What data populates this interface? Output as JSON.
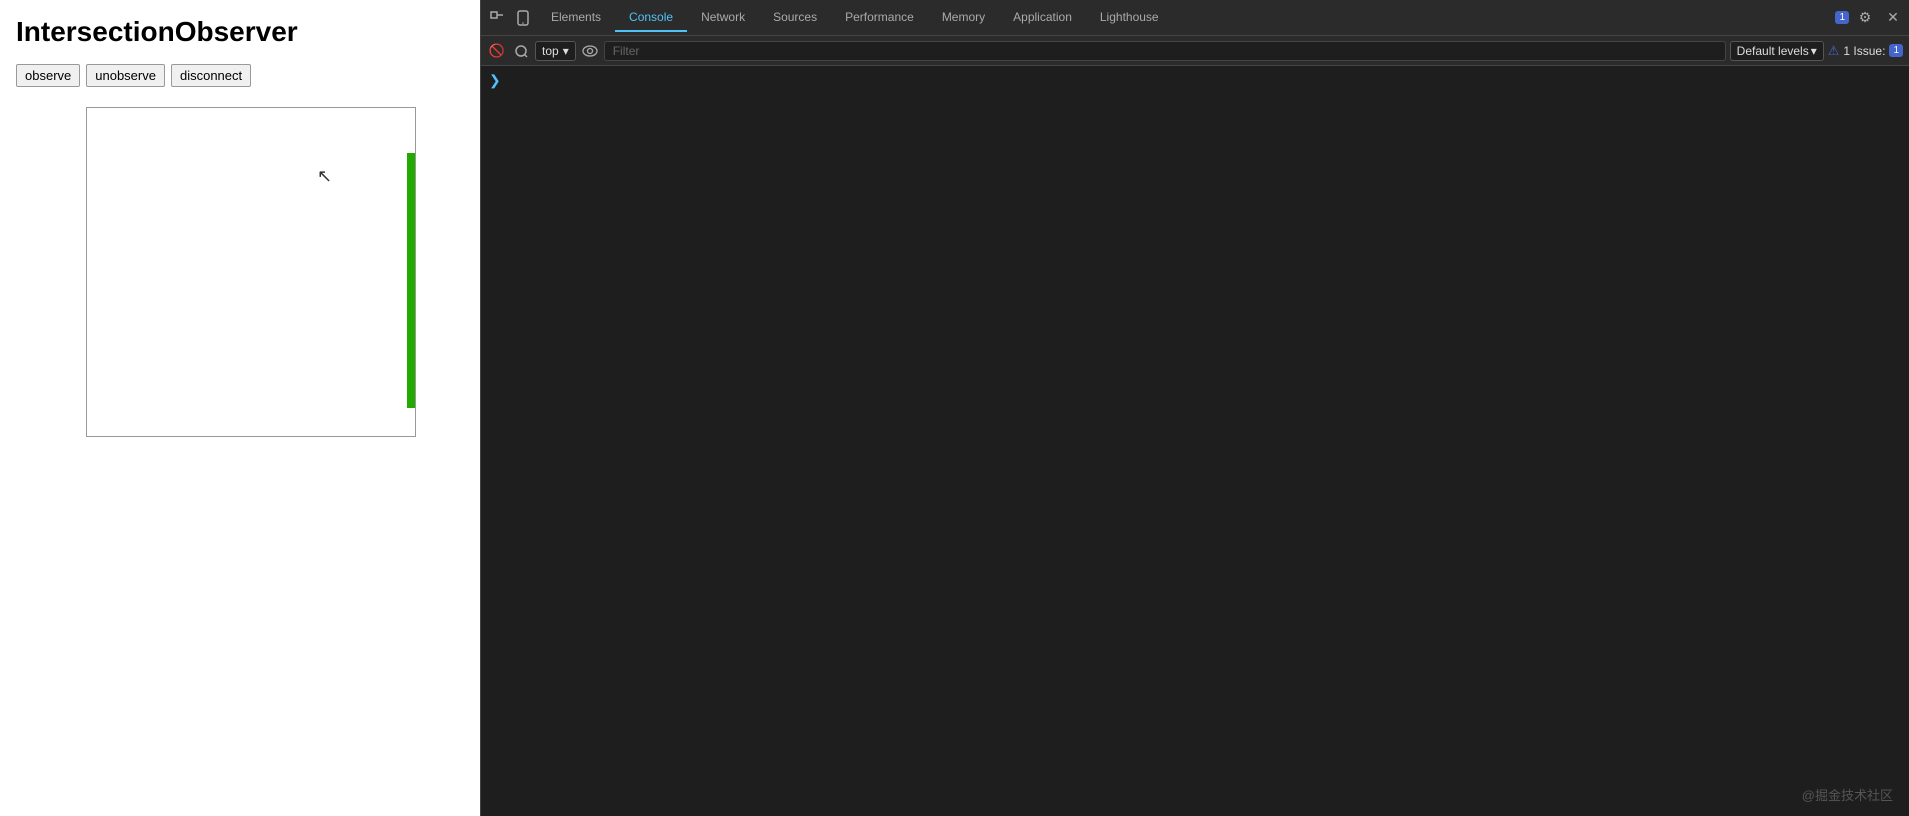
{
  "page": {
    "title": "IntersectionObserver",
    "buttons": [
      {
        "label": "observe",
        "id": "observe-btn"
      },
      {
        "label": "unobserve",
        "id": "unobserve-btn"
      },
      {
        "label": "disconnect",
        "id": "disconnect-btn"
      }
    ]
  },
  "devtools": {
    "tabs": [
      {
        "label": "Elements",
        "active": false
      },
      {
        "label": "Console",
        "active": true
      },
      {
        "label": "Network",
        "active": false
      },
      {
        "label": "Sources",
        "active": false
      },
      {
        "label": "Performance",
        "active": false
      },
      {
        "label": "Memory",
        "active": false
      },
      {
        "label": "Application",
        "active": false
      },
      {
        "label": "Lighthouse",
        "active": false
      }
    ],
    "console": {
      "top_selector": "top",
      "filter_placeholder": "Filter",
      "default_levels": "Default levels",
      "issues_label": "1 Issue:",
      "issues_count": "1"
    }
  },
  "watermark": "@掘金技术社区",
  "icons": {
    "inspect": "⬚",
    "mobile": "⊡",
    "ban": "⊘",
    "eye": "◉",
    "chevron_down": "▾",
    "settings": "⚙",
    "close": "✕",
    "more": "⋮",
    "ellipsis": "…",
    "chevron_right": "❯",
    "warning": "⚠"
  }
}
